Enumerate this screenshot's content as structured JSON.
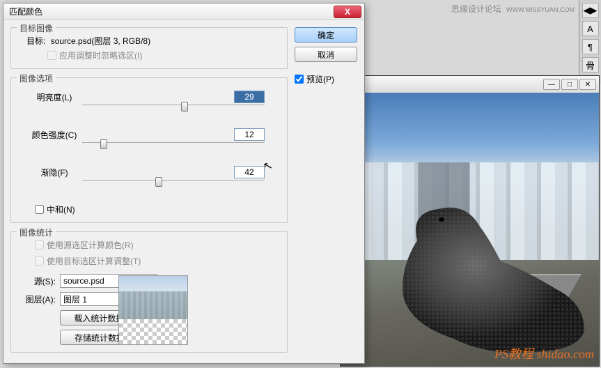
{
  "watermark": {
    "text1": "思缘设计论坛",
    "text2": "WWW.MISSYUAN.COM",
    "bottom": "PS教程 shidao.com"
  },
  "dialog": {
    "title": "匹配颜色",
    "close": "X",
    "buttons": {
      "ok": "确定",
      "cancel": "取消"
    },
    "preview": {
      "label": "预览(P)",
      "checked": true
    },
    "targetGroup": {
      "title": "目标图像",
      "targetLabel": "目标:",
      "targetValue": "source.psd(图层 3, RGB/8)",
      "ignoreSel": {
        "label": "应用调整时忽略选区(I)",
        "checked": false
      }
    },
    "optionsGroup": {
      "title": "图像选项",
      "luminance": {
        "label": "明亮度(L)",
        "value": "29",
        "pos": 56
      },
      "intensity": {
        "label": "颜色强度(C)",
        "value": "12",
        "pos": 12
      },
      "fade": {
        "label": "渐隐(F)",
        "value": "42",
        "pos": 42
      },
      "neutralize": {
        "label": "中和(N)",
        "checked": false
      }
    },
    "statsGroup": {
      "title": "图像统计",
      "useSourceSel": {
        "label": "使用源选区计算颜色(R)",
        "checked": false
      },
      "useTargetSel": {
        "label": "使用目标选区计算调整(T)",
        "checked": false
      },
      "source": {
        "label": "源(S):",
        "value": "source.psd"
      },
      "layer": {
        "label": "图层(A):",
        "value": "图层 1"
      },
      "loadBtn": "载入统计数据(O)...",
      "saveBtn": "存储统计数据(V)..."
    }
  },
  "panels": {
    "icons": [
      "◀▶",
      "A",
      "¶",
      "骨"
    ]
  }
}
